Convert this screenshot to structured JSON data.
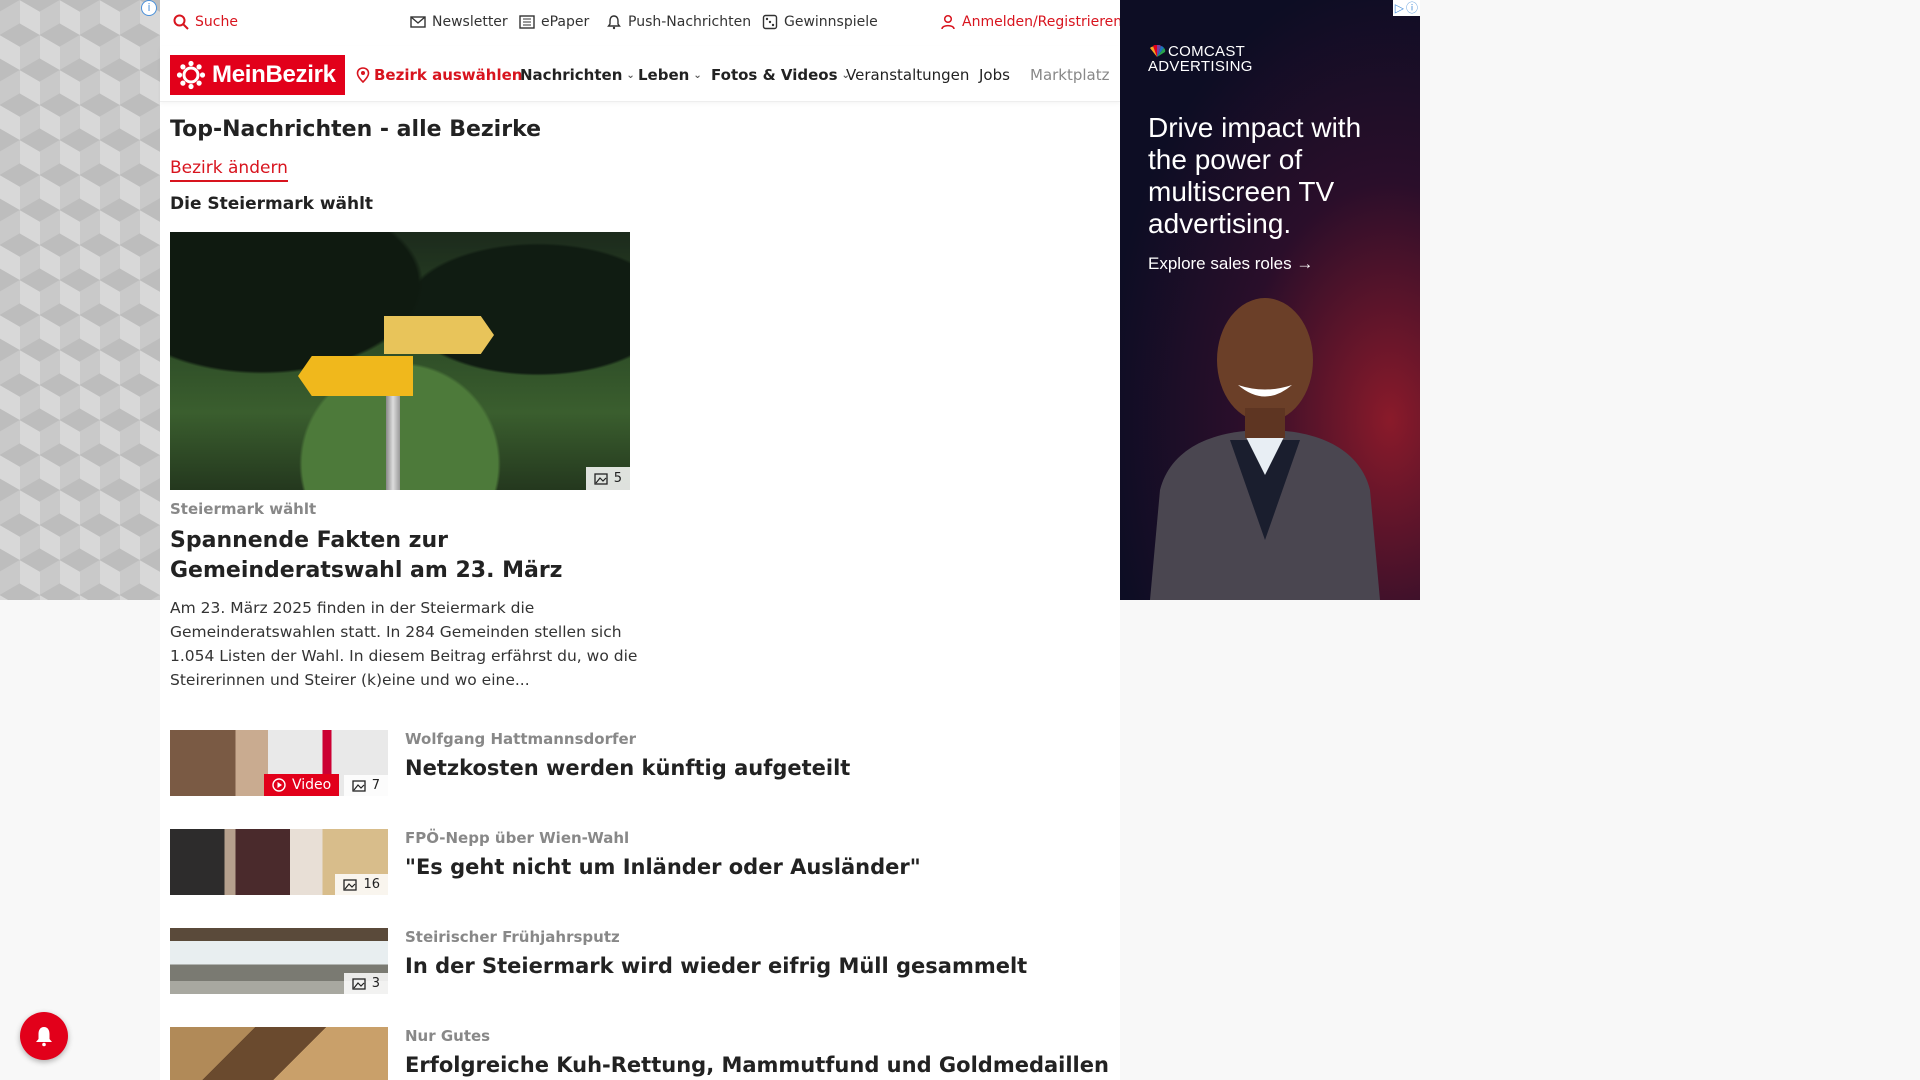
{
  "topbar": {
    "search": "Suche",
    "newsletter": "Newsletter",
    "epaper": "ePaper",
    "push": "Push-Nachrichten",
    "gewinnspiele": "Gewinnspiele",
    "login": "Anmelden/Registrieren"
  },
  "nav": {
    "logo": "MeinBezirk",
    "district": "Bezirk auswählen",
    "items": [
      "Nachrichten",
      "Leben",
      "Fotos & Videos",
      "Veranstaltungen",
      "Jobs",
      "Marktplatz"
    ]
  },
  "page": {
    "title": "Top-Nachrichten - alle Bezirke",
    "change_link": "Bezirk ändern",
    "subhead": "Die Steiermark wählt"
  },
  "hero": {
    "photo_count": "5",
    "kicker": "Steiermark wählt",
    "title": "Spannende Fakten zur Gemeinderatswahl am 23. März",
    "teaser": "Am 23. März 2025 finden in der Steiermark die Gemeinderatswahlen statt. In 284 Gemeinden stellen sich 1.054 Listen der Wahl. In diesem Beitrag erfährst du, wo die Steirerinnen und Steirer (k)eine und wo eine..."
  },
  "articles": [
    {
      "kicker": "Wolfgang Hattmannsdorfer",
      "title": "Netzkosten werden künftig aufgeteilt",
      "photos": "7",
      "video": "Video"
    },
    {
      "kicker": "FPÖ-Nepp über Wien-Wahl",
      "title": "\"Es geht nicht um Inländer oder Ausländer\"",
      "photos": "16"
    },
    {
      "kicker": "Steirischer Frühjahrsputz",
      "title": "In der Steiermark wird wieder eifrig Müll gesammelt",
      "photos": "3"
    },
    {
      "kicker": "Nur Gutes",
      "title": "Erfolgreiche Kuh-Rettung, Mammutfund und Goldmedaillen"
    }
  ],
  "ad": {
    "brand_line1": "COMCAST",
    "brand_line2": "ADVERTISING",
    "headline": "Drive impact with the power of multiscreen TV advertising.",
    "cta": "Explore sales roles →"
  },
  "colors": {
    "brand_red": "#e2001a",
    "link_red": "#d8141e"
  }
}
